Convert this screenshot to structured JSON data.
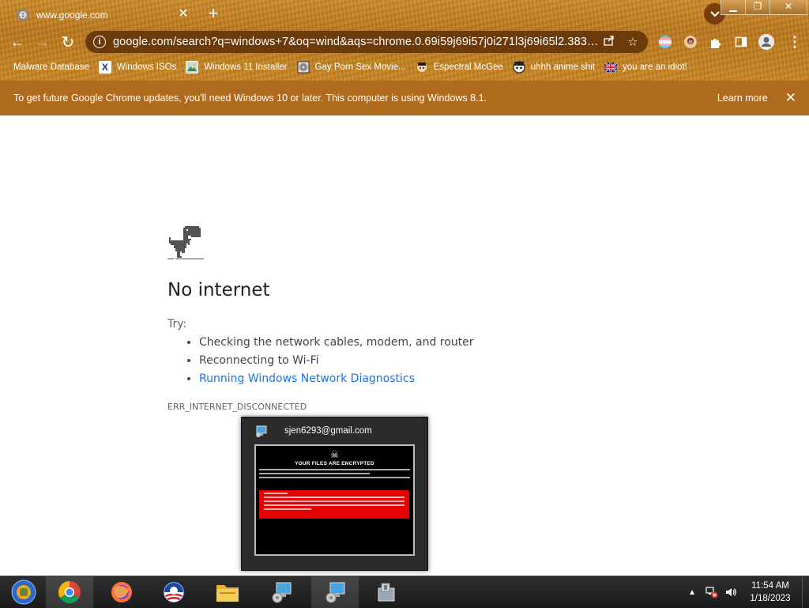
{
  "tab": {
    "title": "www.google.com",
    "close": "✕"
  },
  "new_tab": "+",
  "window_controls": {
    "minimize": "▁",
    "restore": "❐",
    "close": "✕"
  },
  "toolbar": {
    "back": "←",
    "forward": "→",
    "reload": "↻",
    "url": "google.com/search?q=windows+7&oq=wind&aqs=chrome.0.69i59j69i57j0i271l3j69i65l2.383…",
    "info_icon": "i"
  },
  "bookmarks": [
    {
      "label": "Malware Database",
      "icon": "none"
    },
    {
      "label": "Windows ISOs",
      "icon": "x-logo"
    },
    {
      "label": "Windows 11 Installer",
      "icon": "image"
    },
    {
      "label": "Gay Porn Sex Movie...",
      "icon": "disc"
    },
    {
      "label": "Espectral McGee",
      "icon": "avatar"
    },
    {
      "label": "uhhh anime shit",
      "icon": "anime"
    },
    {
      "label": "you are an idiot!",
      "icon": "flag"
    }
  ],
  "infobar": {
    "message": "To get future Google Chrome updates, you'll need Windows 10 or later. This computer is using Windows 8.1.",
    "learn_more": "Learn more",
    "close": "✕"
  },
  "error_page": {
    "title": "No internet",
    "try_label": "Try:",
    "suggestions": [
      "Checking the network cables, modem, and router",
      "Reconnecting to Wi-Fi"
    ],
    "diagnostics_link": "Running Windows Network Diagnostics",
    "error_code": "ERR_INTERNET_DISCONNECTED"
  },
  "thumbnail": {
    "title": "sjen6293@gmail.com",
    "preview_heading": "YOUR FILES ARE ENCRYPTED"
  },
  "clock": {
    "time": "11:54 AM",
    "date": "1/18/2023"
  },
  "colors": {
    "frame": "#b7761d",
    "omnibox": "#6d3a0a",
    "infobar": "#b06a1d",
    "link": "#1a73e8",
    "taskbar": "#1f1f1f",
    "ransom_red": "#e40000"
  }
}
